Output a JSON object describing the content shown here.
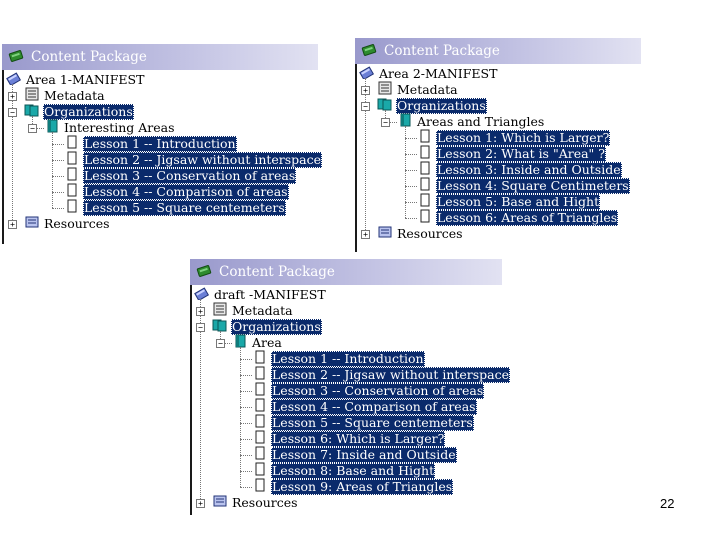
{
  "panels": [
    {
      "title": "Content Package",
      "manifest": "Area 1-MANIFEST",
      "metadata": "Metadata",
      "organizations": "Organizations",
      "organization_item": "Interesting Areas",
      "lessons": [
        "Lesson 1 -- Introduction",
        "Lesson 2 -- Jigsaw without interspace",
        "Lesson 3 -- Conservation of areas",
        "Lesson 4 -- Comparison of areas",
        "Lesson 5 -- Square centemeters"
      ],
      "resources": "Resources"
    },
    {
      "title": "Content Package",
      "manifest": "Area 2-MANIFEST",
      "metadata": "Metadata",
      "organizations": "Organizations",
      "organization_item": "Areas and Triangles",
      "lessons": [
        "Lesson 1: Which is Larger?",
        "Lesson 2: What is \"Area\" ?",
        "Lesson 3: Inside and Outside",
        "Lesson 4: Square Centimeters",
        "Lesson 5: Base and Hight",
        "Lesson 6: Areas of Triangles"
      ],
      "resources": "Resources"
    },
    {
      "title": "Content Package",
      "manifest": "draft -MANIFEST",
      "metadata": "Metadata",
      "organizations": "Organizations",
      "organization_item": "Area",
      "lessons": [
        "Lesson 1 -- Introduction",
        "Lesson 2 -- Jigsaw without interspace",
        "Lesson 3 -- Conservation of areas",
        "Lesson 4 -- Comparison of areas",
        "Lesson 5 -- Square centemeters",
        "Lesson 6: Which is Larger?",
        "Lesson 7: Inside and Outside",
        "Lesson 8: Base and Hight",
        "Lesson 9: Areas of Triangles"
      ],
      "resources": "Resources"
    }
  ],
  "page_number": "22",
  "colors": {
    "titlebar_start": "#9999cc",
    "titlebar_end": "#e2e2f2",
    "selection": "#0a2a6b",
    "package_icon": "#2e8b2e",
    "org_icon": "#1aa8a8"
  },
  "icons": {
    "content_package": "package-icon",
    "manifest": "manifest-icon",
    "metadata": "metadata-icon",
    "organizations": "organizations-icon",
    "organization_item": "organization-item-icon",
    "lesson": "lesson-icon",
    "resources": "resources-icon"
  }
}
